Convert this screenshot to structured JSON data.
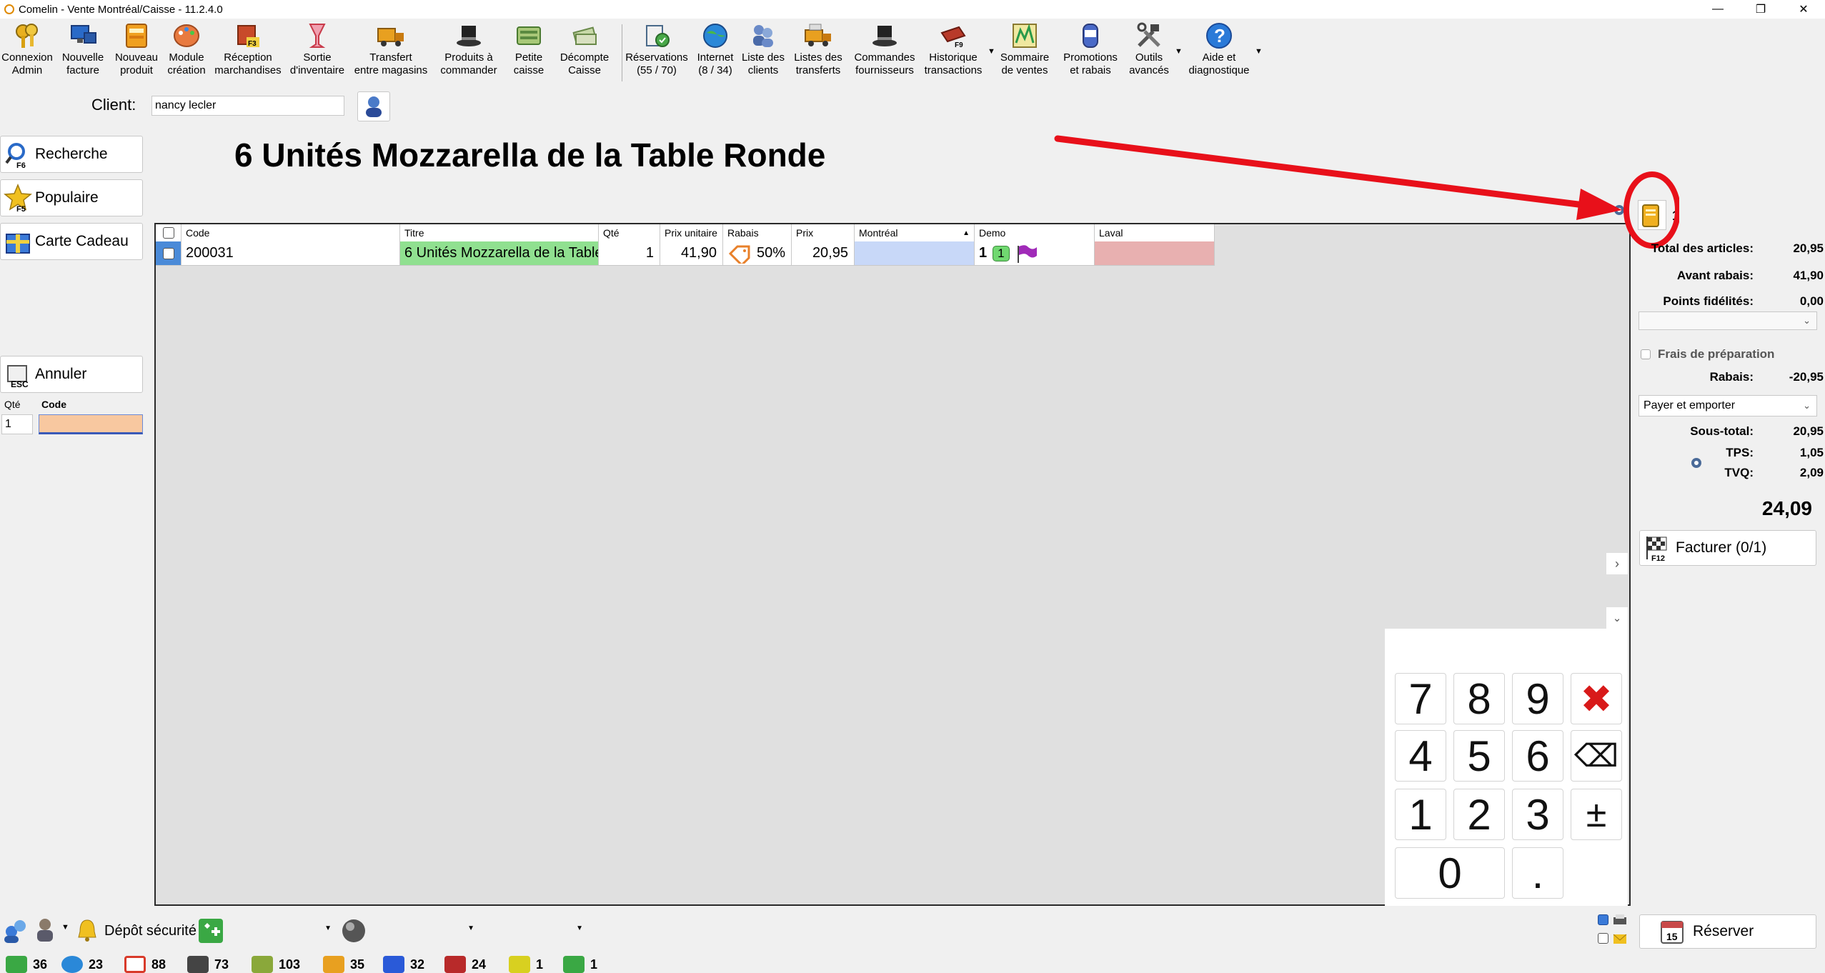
{
  "window": {
    "title": "Comelin - Vente Montréal/Caisse - 11.2.4.0",
    "minimize": "—",
    "maximize": "❐",
    "close": "✕"
  },
  "toolbar": {
    "items": [
      {
        "line1": "Connexion",
        "line2": "Admin",
        "icon": "keys-icon"
      },
      {
        "line1": "Nouvelle",
        "line2": "facture",
        "icon": "computer-icon"
      },
      {
        "line1": "Nouveau",
        "line2": "produit",
        "icon": "box-icon"
      },
      {
        "line1": "Module",
        "line2": "création",
        "icon": "palette-icon"
      },
      {
        "line1": "Réception",
        "line2": "marchandises",
        "icon": "receive-icon"
      },
      {
        "line1": "Sortie",
        "line2": "d'inventaire",
        "icon": "glass-icon"
      },
      {
        "line1": "Transfert",
        "line2": "entre magasins",
        "icon": "truck-icon"
      },
      {
        "line1": "Produits à",
        "line2": "commander",
        "icon": "top-hat-icon"
      },
      {
        "line1": "Petite",
        "line2": "caisse",
        "icon": "cash-icon"
      },
      {
        "line1": "Décompte",
        "line2": "Caisse",
        "icon": "money-count-icon"
      },
      {
        "line1": "Réservations",
        "line2": "(55 / 70)",
        "icon": "reservation-icon"
      },
      {
        "line1": "Internet",
        "line2": "(8 / 34)",
        "icon": "globe-icon"
      },
      {
        "line1": "Liste des",
        "line2": "clients",
        "icon": "clients-icon"
      },
      {
        "line1": "Listes des",
        "line2": "transferts",
        "icon": "transfer-truck-icon"
      },
      {
        "line1": "Commandes",
        "line2": "fournisseurs",
        "icon": "supplier-hat-icon"
      },
      {
        "line1": "Historique",
        "line2": "transactions",
        "icon": "history-book-icon"
      },
      {
        "line1": "Sommaire",
        "line2": "de ventes",
        "icon": "sales-chart-icon"
      },
      {
        "line1": "Promotions",
        "line2": "et rabais",
        "icon": "promotion-icon"
      },
      {
        "line1": "Outils",
        "line2": "avancés",
        "icon": "tools-icon"
      },
      {
        "line1": "Aide et",
        "line2": "diagnostique",
        "icon": "help-icon"
      }
    ]
  },
  "client": {
    "label": "Client:",
    "value": "nancy lecler"
  },
  "sidebar": {
    "search": {
      "label": "Recherche",
      "key": "F6"
    },
    "popular": {
      "label": "Populaire",
      "key": "F5"
    },
    "gift_card": {
      "label": "Carte Cadeau"
    },
    "cancel": {
      "label": "Annuler",
      "key": "ESC"
    },
    "qty_header": "Qté",
    "code_header": "Code",
    "qty_value": "1"
  },
  "product_title": "6 Unités Mozzarella de la Table Ronde",
  "grid": {
    "columns": [
      "Code",
      "Titre",
      "Qté",
      "Prix unitaire",
      "Rabais",
      "Prix",
      "Montréal",
      "Demo",
      "Laval"
    ],
    "rows": [
      {
        "code": "200031",
        "title": "6 Unités Mozzarella de la Table Ronde",
        "qty": "1",
        "unit_price": "41,90",
        "discount": "50%",
        "price": "20,95",
        "montreal": "",
        "demo_qty": "1",
        "demo_badge": "1",
        "laval": ""
      }
    ]
  },
  "cart_count": "1",
  "totals": {
    "total_articles_label": "Total des articles:",
    "total_articles": "20,95",
    "before_discount_label": "Avant rabais:",
    "before_discount": "41,90",
    "loyalty_label": "Points fidélités:",
    "loyalty": "0,00",
    "prep_fee_label": "Frais de préparation",
    "discount_label": "Rabais:",
    "discount": "-20,95",
    "mode": "Payer et emporter",
    "subtotal_label": "Sous-total:",
    "subtotal": "20,95",
    "tps_label": "TPS:",
    "tps": "1,05",
    "tvq_label": "TVQ:",
    "tvq": "2,09",
    "grand_total": "24,09",
    "invoice_button": "Facturer (0/1)",
    "invoice_key": "F12"
  },
  "keypad": {
    "keys": [
      "7",
      "8",
      "9",
      "4",
      "5",
      "6",
      "1",
      "2",
      "3",
      "0",
      "."
    ],
    "clear": "✖",
    "backspace": "⌫",
    "plusminus": "±"
  },
  "statusbar": {
    "deposit_label": "Dépôt sécurité",
    "reserve_button": "Réserver",
    "reserve_day": "15"
  },
  "bottom_counts": [
    {
      "value": "36",
      "color": "#3aa844"
    },
    {
      "value": "23",
      "color": "#2a88d8"
    },
    {
      "value": "88",
      "color": "#d83a2a"
    },
    {
      "value": "73",
      "color": "#444444"
    },
    {
      "value": "103",
      "color": "#8aa83a"
    },
    {
      "value": "35",
      "color": "#e8a020"
    },
    {
      "value": "32",
      "color": "#2a5ad8"
    },
    {
      "value": "24",
      "color": "#b82a2a"
    },
    {
      "value": "1",
      "color": "#d8d020"
    },
    {
      "value": "1",
      "color": "#3aa844"
    }
  ],
  "annotation": {
    "color": "#e8101a"
  }
}
